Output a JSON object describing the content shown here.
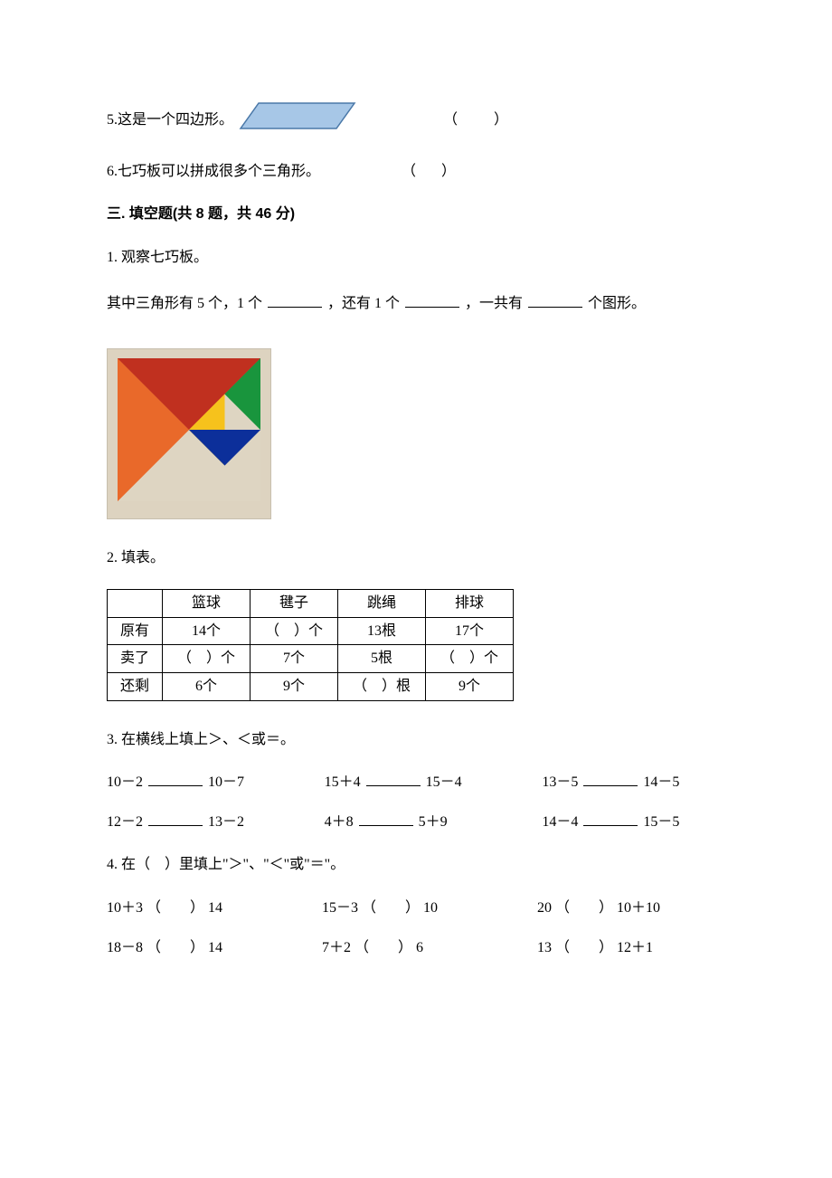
{
  "tf": {
    "q5": {
      "num": "5.",
      "text": "这是一个四边形。",
      "paren_l": "（",
      "paren_r": "）"
    },
    "q6": {
      "num": "6.",
      "text": "七巧板可以拼成很多个三角形。",
      "paren_l": "（",
      "paren_r": "）"
    }
  },
  "section3": {
    "heading": "三. 填空题(共 8 题，共 46 分)"
  },
  "q1": {
    "num": "1.",
    "text1": "观察七巧板。",
    "line_a": "其中三角形有 5 个，1 个",
    "line_b": "，还有 1 个",
    "line_c": "，一共有",
    "line_d": "个图形。"
  },
  "q2": {
    "num": "2.",
    "title": "填表。",
    "headers": [
      "",
      "篮球",
      "毽子",
      "跳绳",
      "排球"
    ],
    "row1_label": "原有",
    "row1": [
      "14个",
      "（　）个",
      "13根",
      "17个"
    ],
    "row2_label": "卖了",
    "row2": [
      "（　）个",
      "7个",
      "5根",
      "（　）个"
    ],
    "row3_label": "还剩",
    "row3": [
      "6个",
      "9个",
      "（　）根",
      "9个"
    ]
  },
  "q3": {
    "num": "3.",
    "title": "在横线上填上＞、＜或＝。",
    "items": [
      {
        "l": "10－2",
        "r": "10－7"
      },
      {
        "l": "15＋4",
        "r": "15－4"
      },
      {
        "l": "13－5",
        "r": "14－5"
      },
      {
        "l": "12－2",
        "r": "13－2"
      },
      {
        "l": "4＋8",
        "r": "5＋9"
      },
      {
        "l": "14－4",
        "r": "15－5"
      }
    ]
  },
  "q4": {
    "num": "4.",
    "title": "在（　）里填上\"＞\"、\"＜\"或\"＝\"。",
    "items": [
      {
        "l": "10＋3",
        "mid": "（　　）",
        "r": "14"
      },
      {
        "l": "15－3",
        "mid": "（　　）",
        "r": "10"
      },
      {
        "l": "20",
        "mid": "（　　）",
        "r": "10＋10"
      },
      {
        "l": "18－8",
        "mid": "（　　）",
        "r": "14"
      },
      {
        "l": "7＋2",
        "mid": "（　　）",
        "r": "6"
      },
      {
        "l": "13",
        "mid": "（　　）",
        "r": "12＋1"
      }
    ]
  }
}
